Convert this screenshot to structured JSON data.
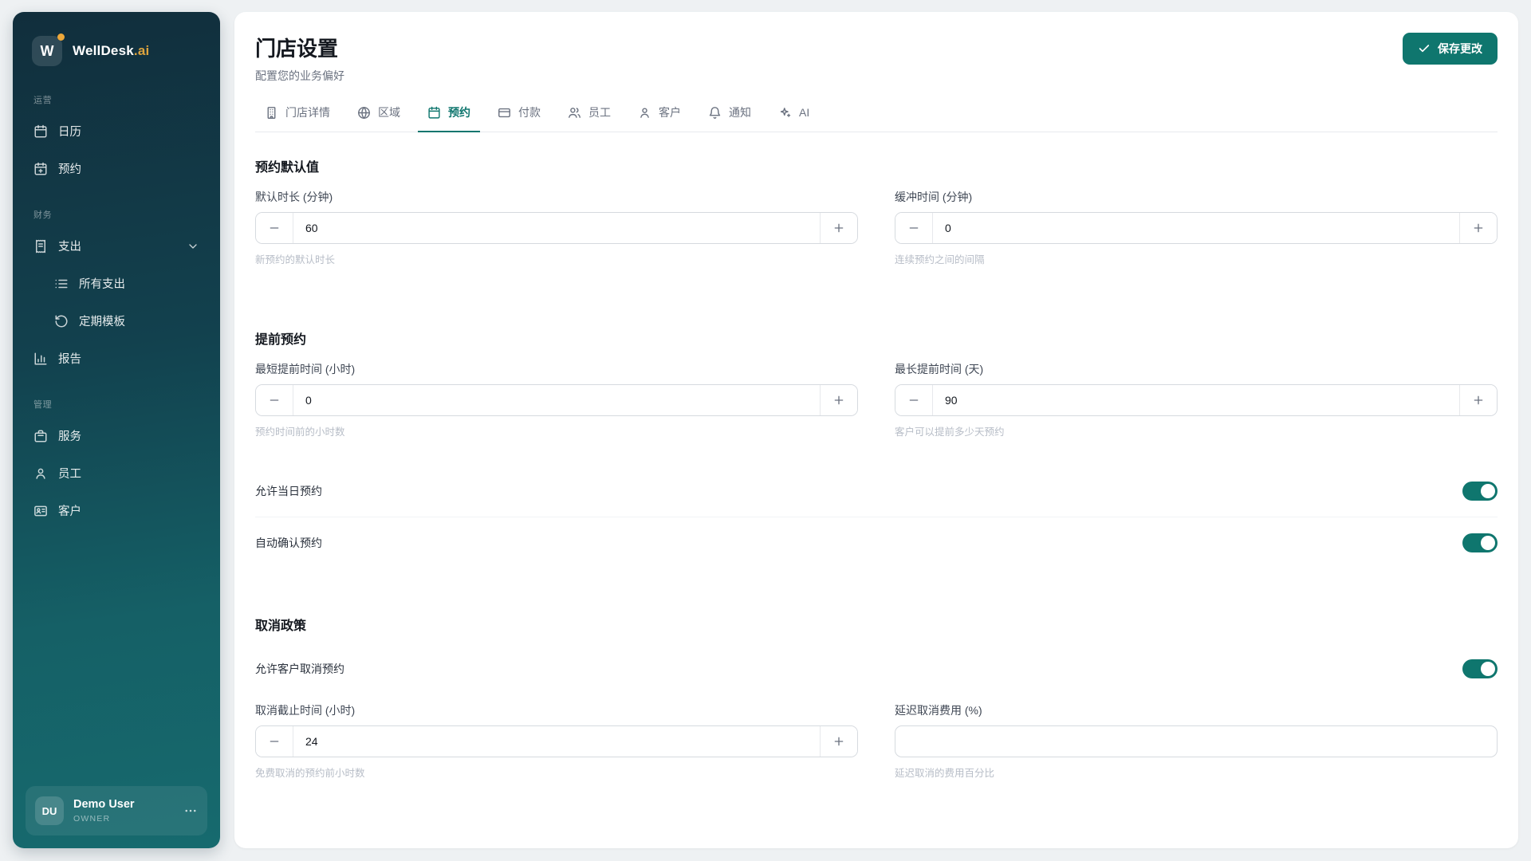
{
  "app": {
    "logo_letter": "W",
    "brand": "WellDesk",
    "brand_suffix": ".ai"
  },
  "sidebar": {
    "sections": [
      {
        "label": "运营",
        "items": [
          {
            "icon": "calendar-icon",
            "label": "日历"
          },
          {
            "icon": "calendar-plus-icon",
            "label": "预约"
          }
        ]
      },
      {
        "label": "财务",
        "items": [
          {
            "icon": "receipt-icon",
            "label": "支出",
            "expanded": true
          },
          {
            "icon": "list-icon",
            "label": "所有支出",
            "child": true
          },
          {
            "icon": "rotate-ccw-icon",
            "label": "定期模板",
            "child": true
          },
          {
            "icon": "bar-chart-icon",
            "label": "报告"
          }
        ]
      },
      {
        "label": "管理",
        "items": [
          {
            "icon": "briefcase-icon",
            "label": "服务"
          },
          {
            "icon": "user-icon",
            "label": "员工"
          },
          {
            "icon": "id-card-icon",
            "label": "客户"
          }
        ]
      }
    ],
    "user": {
      "initials": "DU",
      "name": "Demo User",
      "role": "OWNER"
    }
  },
  "header": {
    "title": "门店设置",
    "subtitle": "配置您的业务偏好",
    "save_label": "保存更改"
  },
  "tabs": [
    {
      "icon": "building-icon",
      "label": "门店详情",
      "active": false
    },
    {
      "icon": "globe-icon",
      "label": "区域",
      "active": false
    },
    {
      "icon": "calendar-icon",
      "label": "预约",
      "active": true
    },
    {
      "icon": "credit-card-icon",
      "label": "付款",
      "active": false
    },
    {
      "icon": "users-icon",
      "label": "员工",
      "active": false
    },
    {
      "icon": "user-icon",
      "label": "客户",
      "active": false
    },
    {
      "icon": "bell-icon",
      "label": "通知",
      "active": false
    },
    {
      "icon": "sparkles-icon",
      "label": "AI",
      "active": false
    }
  ],
  "booking_defaults": {
    "title": "预约默认值",
    "duration": {
      "label": "默认时长 (分钟)",
      "value": "60",
      "helper": "新预约的默认时长"
    },
    "buffer": {
      "label": "缓冲时间 (分钟)",
      "value": "0",
      "helper": "连续预约之间的间隔"
    }
  },
  "advance_booking": {
    "title": "提前预约",
    "min": {
      "label": "最短提前时间 (小时)",
      "value": "0",
      "helper": "预约时间前的小时数"
    },
    "max": {
      "label": "最长提前时间 (天)",
      "value": "90",
      "helper": "客户可以提前多少天预约"
    }
  },
  "toggles": {
    "same_day": {
      "label": "允许当日预约",
      "on": true
    },
    "auto_confirm": {
      "label": "自动确认预约",
      "on": true
    }
  },
  "cancellation": {
    "title": "取消政策",
    "allow_cancel": {
      "label": "允许客户取消预约",
      "on": true
    },
    "cutoff": {
      "label": "取消截止时间 (小时)",
      "value": "24",
      "helper": "免费取消的预约前小时数"
    },
    "late_fee": {
      "label": "延迟取消费用 (%)",
      "value": "",
      "helper": "延迟取消的费用百分比"
    }
  },
  "colors": {
    "primary": "#0f766e",
    "sidebar_top": "#112e3c",
    "sidebar_bottom": "#166a6e",
    "accent_amber": "#dca43e",
    "page_background": "#eef1f3"
  }
}
